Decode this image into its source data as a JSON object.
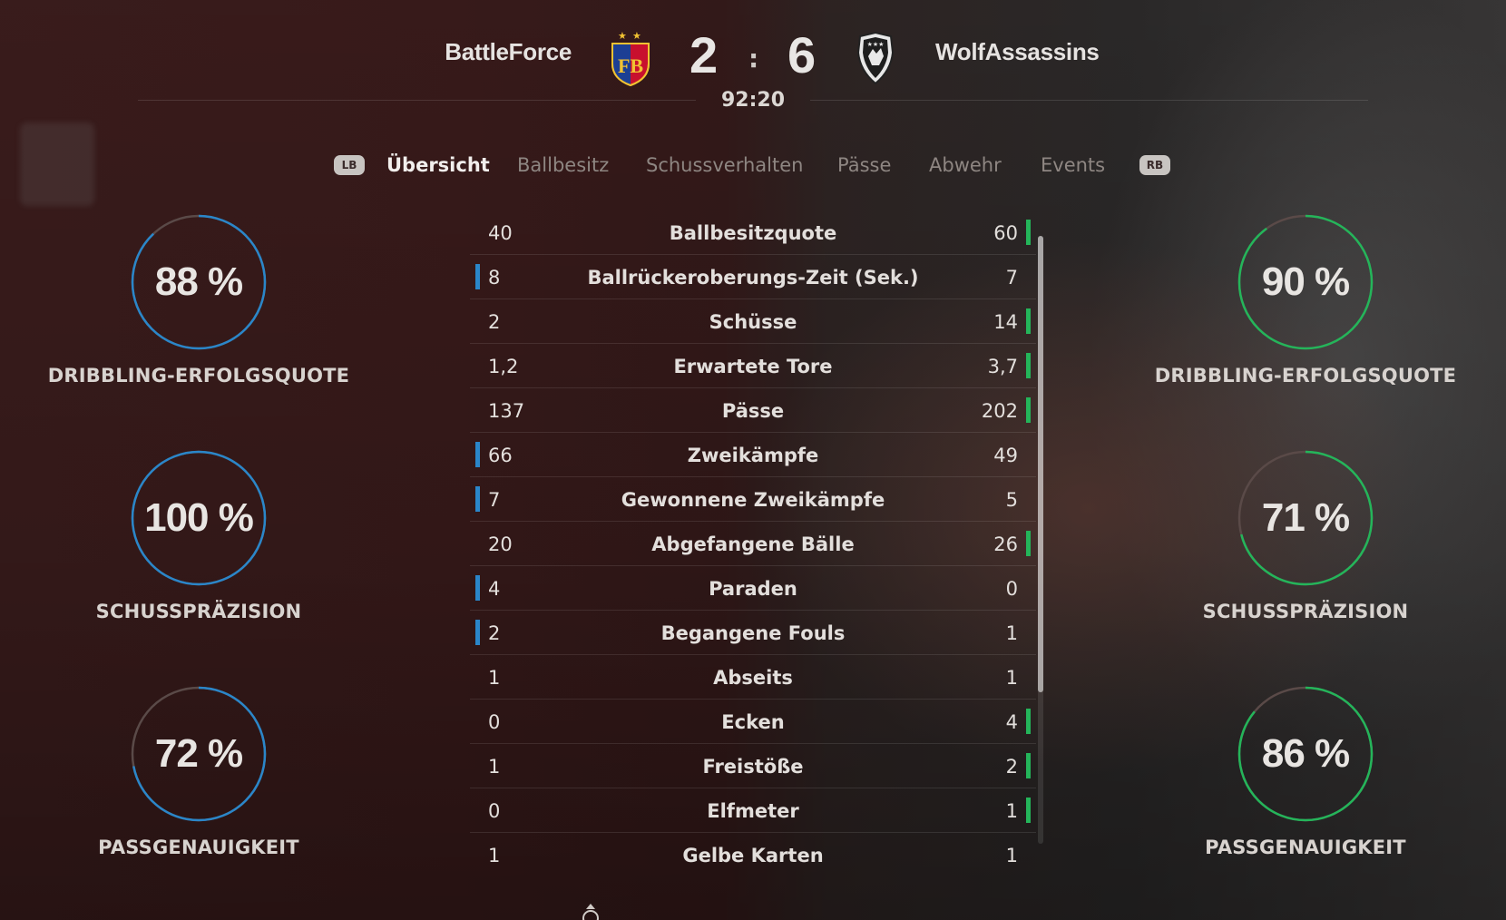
{
  "match": {
    "home_team": "BattleForce",
    "away_team": "WolfAssassins",
    "home_score": "2",
    "away_score": "6",
    "score_separator": ":",
    "clock": "92:20",
    "home_crest_icon": "fcb-crest-icon",
    "away_crest_icon": "wolf-shield-crest-icon"
  },
  "tabs": {
    "left_bumper": "LB",
    "right_bumper": "RB",
    "items": [
      "Übersicht",
      "Ballbesitz",
      "Schussverhalten",
      "Pässe",
      "Abwehr",
      "Events"
    ],
    "active": "Übersicht"
  },
  "gauges": {
    "home": [
      {
        "value": 88,
        "display": "88 %",
        "label": "DRIBBLING-ERFOLGSQUOTE"
      },
      {
        "value": 100,
        "display": "100 %",
        "label": "SCHUSSPRÄZISION"
      },
      {
        "value": 72,
        "display": "72 %",
        "label": "PASSGENAUIGKEIT"
      }
    ],
    "away": [
      {
        "value": 90,
        "display": "90 %",
        "label": "DRIBBLING-ERFOLGSQUOTE"
      },
      {
        "value": 71,
        "display": "71 %",
        "label": "SCHUSSPRÄZISION"
      },
      {
        "value": 86,
        "display": "86 %",
        "label": "PASSGENAUIGKEIT"
      }
    ]
  },
  "stats": [
    {
      "label": "Ballbesitzquote",
      "home": "40",
      "away": "60",
      "leader": "away"
    },
    {
      "label": "Ballrückeroberungs-Zeit (Sek.)",
      "home": "8",
      "away": "7",
      "leader": "home"
    },
    {
      "label": "Schüsse",
      "home": "2",
      "away": "14",
      "leader": "away"
    },
    {
      "label": "Erwartete Tore",
      "home": "1,2",
      "away": "3,7",
      "leader": "away"
    },
    {
      "label": "Pässe",
      "home": "137",
      "away": "202",
      "leader": "away"
    },
    {
      "label": "Zweikämpfe",
      "home": "66",
      "away": "49",
      "leader": "home"
    },
    {
      "label": "Gewonnene Zweikämpfe",
      "home": "7",
      "away": "5",
      "leader": "home"
    },
    {
      "label": "Abgefangene Bälle",
      "home": "20",
      "away": "26",
      "leader": "away"
    },
    {
      "label": "Paraden",
      "home": "4",
      "away": "0",
      "leader": "home"
    },
    {
      "label": "Begangene Fouls",
      "home": "2",
      "away": "1",
      "leader": "home"
    },
    {
      "label": "Abseits",
      "home": "1",
      "away": "1",
      "leader": "none"
    },
    {
      "label": "Ecken",
      "home": "0",
      "away": "4",
      "leader": "away"
    },
    {
      "label": "Freistöße",
      "home": "1",
      "away": "2",
      "leader": "away"
    },
    {
      "label": "Elfmeter",
      "home": "0",
      "away": "1",
      "leader": "away"
    },
    {
      "label": "Gelbe Karten",
      "home": "1",
      "away": "1",
      "leader": "none"
    }
  ],
  "colors": {
    "home_accent": "#2a86c9",
    "away_accent": "#24b55a",
    "ring_track": "#5a4a48"
  }
}
